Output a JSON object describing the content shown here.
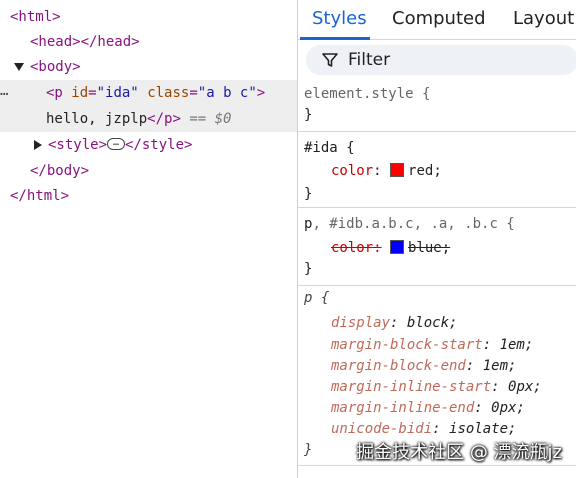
{
  "dom_tree": {
    "line_html_open": "<html>",
    "head_open": "<head>",
    "head_close": "</head>",
    "body_open": "<body>",
    "p_tag_open": "<p",
    "p_attr_id": "id",
    "p_attr_id_val": "\"ida\"",
    "p_attr_class": "class",
    "p_attr_class_val": "\"a b c\"",
    "p_tag_gt": ">",
    "p_text": "hello, jzplp",
    "p_close": "</p>",
    "dollar_zero": "== $0",
    "style_open": "<style>",
    "style_ellipsis": "…",
    "style_close": "</style>",
    "body_close": "</body>",
    "html_close": "</html>",
    "gutter_marker": "…"
  },
  "tabs": {
    "styles": "Styles",
    "computed": "Computed",
    "layout": "Layout"
  },
  "filter": {
    "label": "Filter"
  },
  "rules": {
    "element_style": {
      "selector": "element.style {",
      "close": "}"
    },
    "ida": {
      "selector": "#ida {",
      "prop": "color",
      "colon": ":",
      "value": "red",
      "semicolon": ";",
      "swatch_color": "#ff0000",
      "close": "}"
    },
    "overridden": {
      "selector_match": "p",
      "selector_rest": ", #idb.a.b.c, .a, .b.c {",
      "prop": "color:",
      "value": "blue;",
      "swatch_color": "#0000ff",
      "close": "}"
    },
    "user_agent": {
      "selector": "p {",
      "declarations": [
        {
          "prop": "display",
          "value": "block;"
        },
        {
          "prop": "margin-block-start",
          "value": "1em;"
        },
        {
          "prop": "margin-block-end",
          "value": "1em;"
        },
        {
          "prop": "margin-inline-start",
          "value": "0px;"
        },
        {
          "prop": "margin-inline-end",
          "value": "0px;"
        },
        {
          "prop": "unicode-bidi",
          "value": "isolate;"
        }
      ],
      "close": "}"
    }
  },
  "watermark": "掘金技术社区 @ 漂流瓶jz",
  "colors": {
    "accent": "#1a64d0",
    "tag": "#881280",
    "attr_name": "#994500",
    "attr_value": "#1a1aa6",
    "css_property": "#c80000"
  }
}
